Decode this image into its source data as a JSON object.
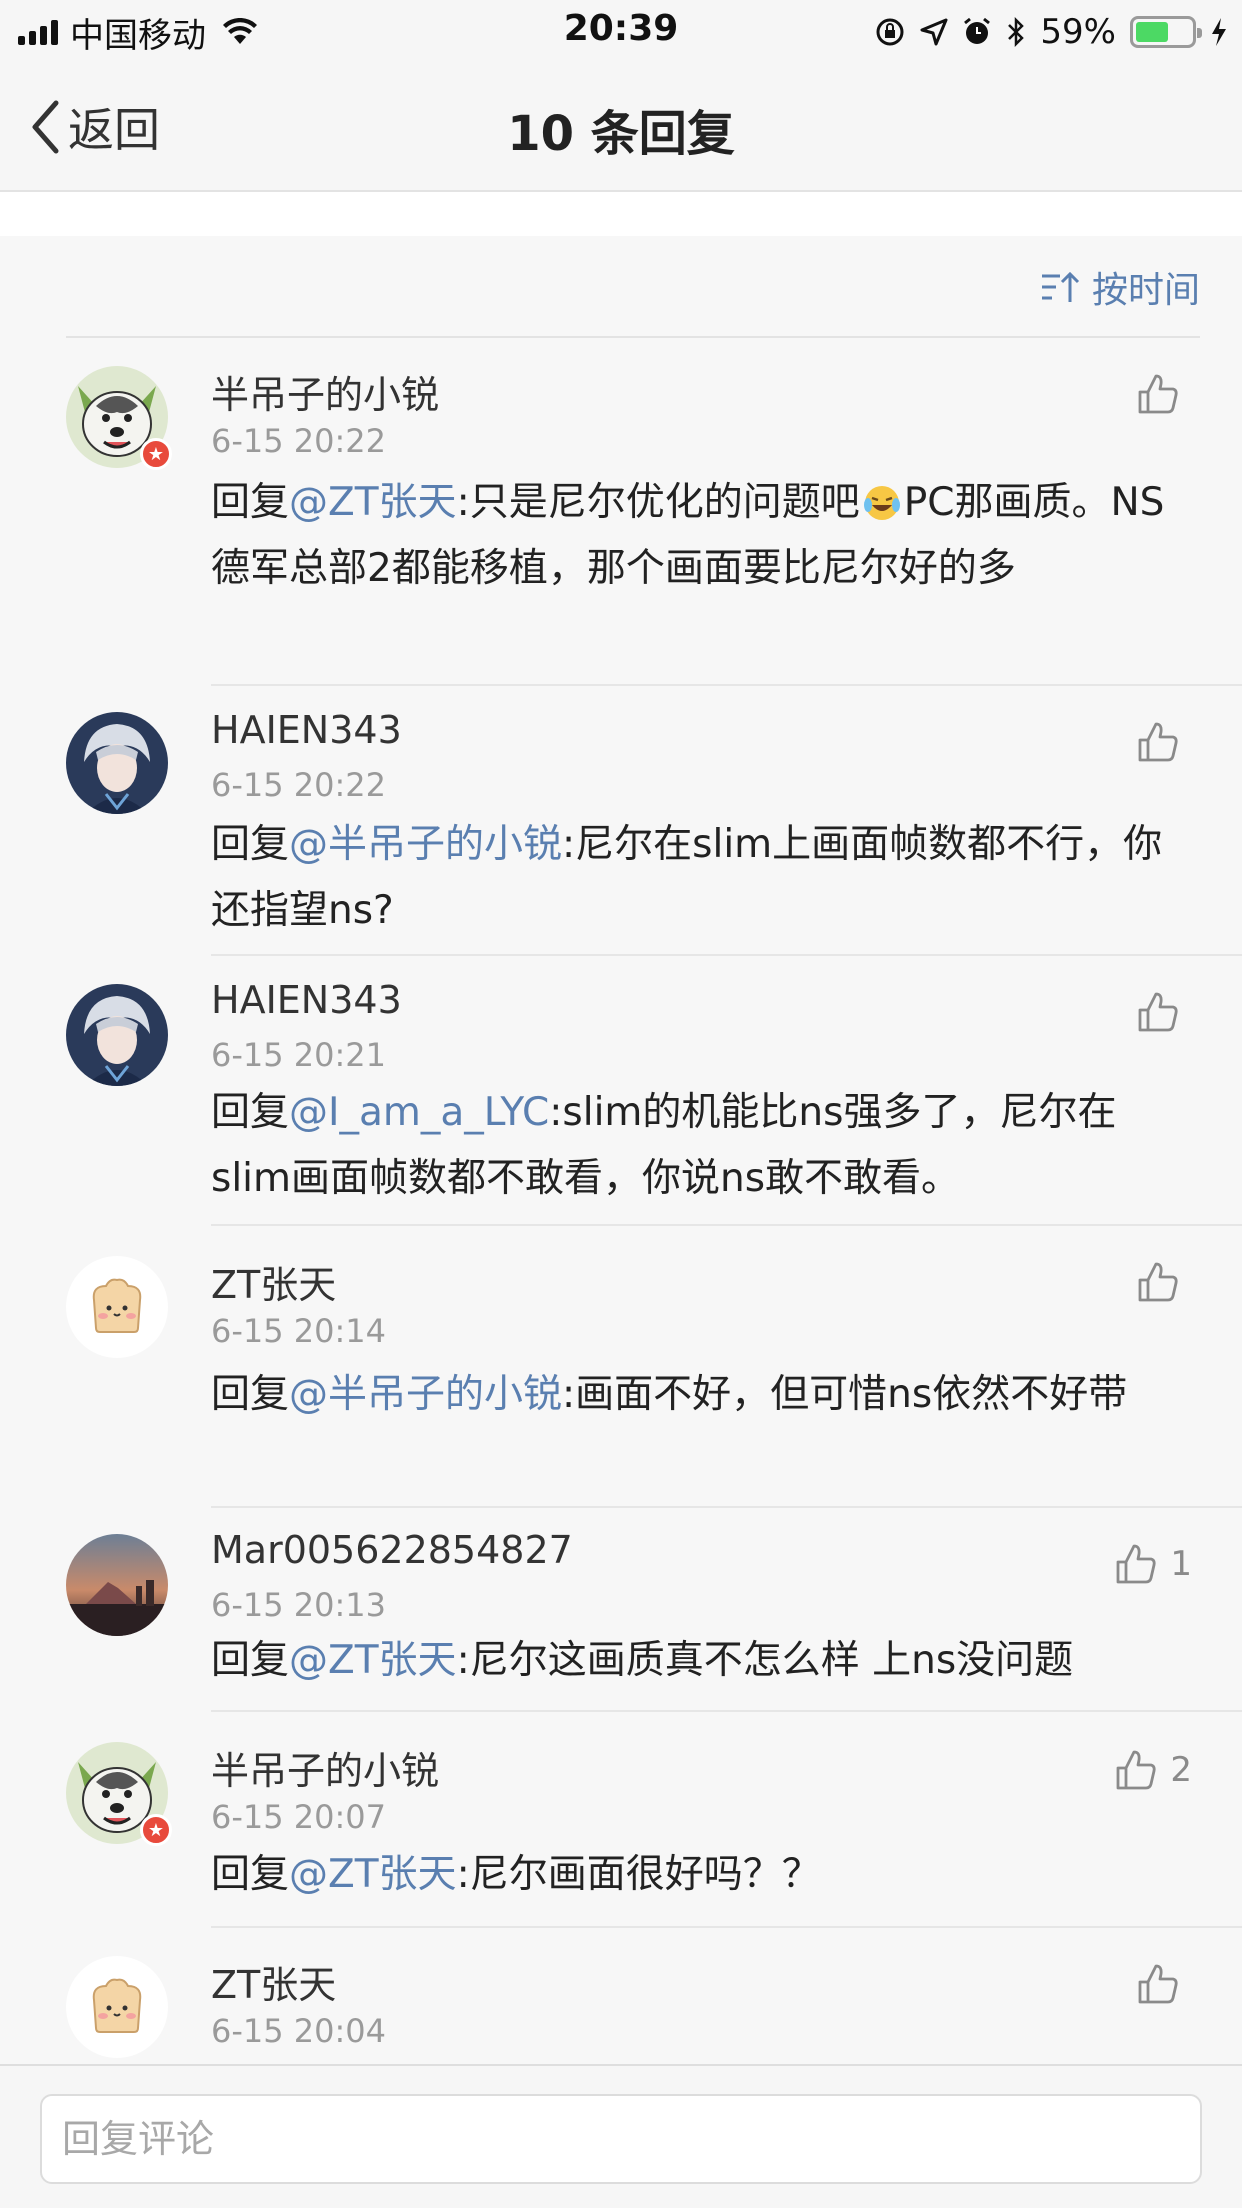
{
  "status_bar": {
    "carrier": "中国移动",
    "time": "20:39",
    "battery": "59%",
    "battery_level": 0.59,
    "battery_color": "#4cd964"
  },
  "nav": {
    "back_label": "返回",
    "title": "10 条回复"
  },
  "sort": {
    "label": "按时间"
  },
  "accent_color": "#5a7fb0",
  "comments": [
    {
      "name": "半吊子的小锐",
      "time": "6-15 20:22",
      "reply_prefix": "回复",
      "mention": "@ZT张天",
      "text": ":只是尼尔优化的问题吧",
      "emoji": "laughing-crying-emoji",
      "text2": "PC那画质。NS德军总部2都能移植，那个画面要比尼尔好的多",
      "likes": ""
    },
    {
      "name": "HAIEN343",
      "time": "6-15 20:22",
      "reply_prefix": "回复",
      "mention": "@半吊子的小锐",
      "text": ":尼尔在slim上画面帧数都不行，你还指望ns?",
      "likes": ""
    },
    {
      "name": "HAIEN343",
      "time": "6-15 20:21",
      "reply_prefix": "回复",
      "mention": "@I_am_a_LYC",
      "text": ":slim的机能比ns强多了，尼尔在slim画面帧数都不敢看，你说ns敢不敢看。",
      "likes": ""
    },
    {
      "name": "ZT张天",
      "time": "6-15 20:14",
      "reply_prefix": "回复",
      "mention": "@半吊子的小锐",
      "text": ":画面不好，但可惜ns依然不好带",
      "likes": ""
    },
    {
      "name": "Mar005622854827",
      "time": "6-15 20:13",
      "reply_prefix": "回复",
      "mention": "@ZT张天",
      "text": ":尼尔这画质真不怎么样 上ns没问题",
      "likes": "1"
    },
    {
      "name": "半吊子的小锐",
      "time": "6-15 20:07",
      "reply_prefix": "回复",
      "mention": "@ZT张天",
      "text": ":尼尔画面很好吗？？",
      "likes": "2"
    },
    {
      "name": "ZT张天",
      "time": "6-15 20:04",
      "likes": ""
    }
  ],
  "reply_box": {
    "placeholder": "回复评论"
  }
}
